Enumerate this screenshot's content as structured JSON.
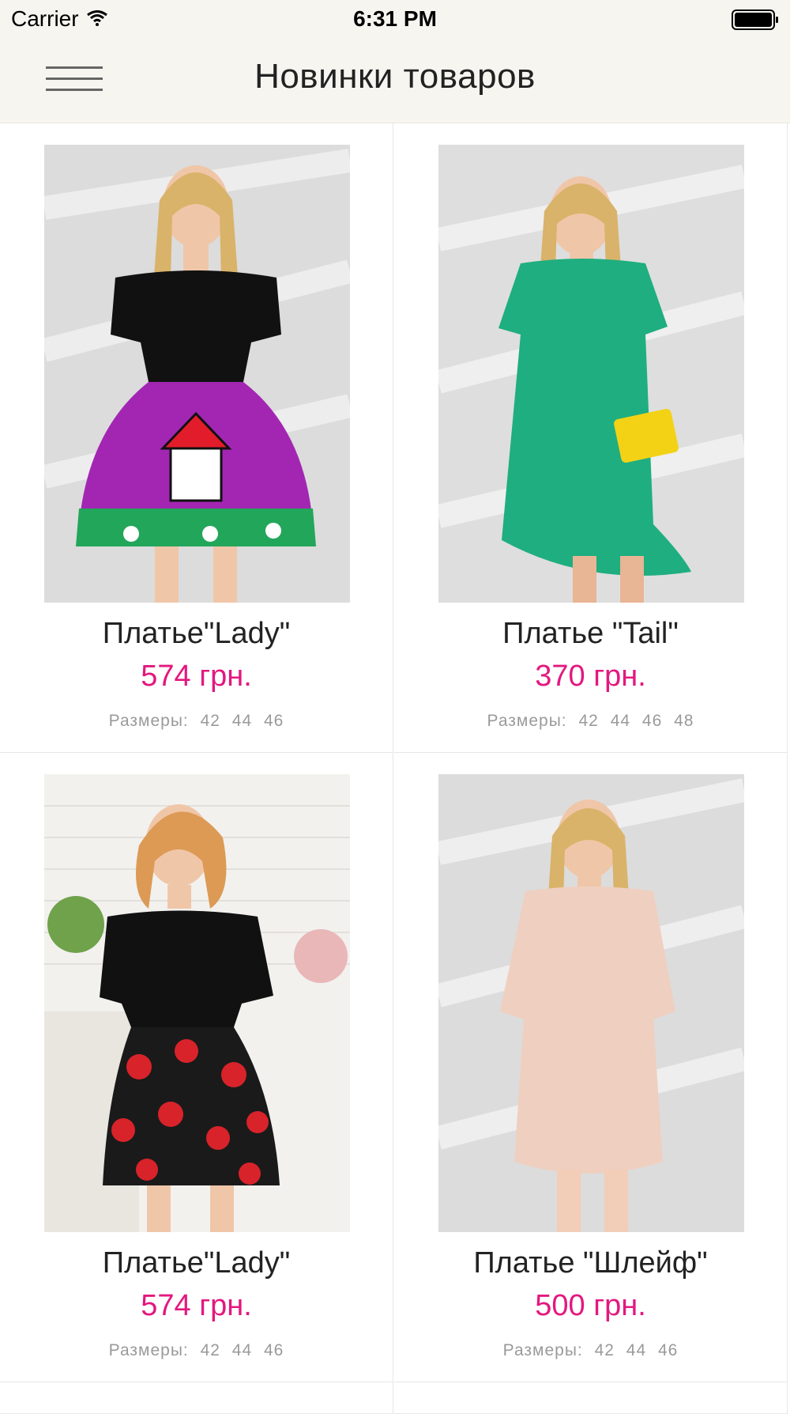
{
  "status_bar": {
    "carrier": "Carrier",
    "time": "6:31 PM"
  },
  "nav": {
    "title": "Новинки товаров",
    "menu_icon": "hamburger-menu-icon"
  },
  "products": [
    {
      "name": "Платье\"Lady\"",
      "price": "574 грн.",
      "sizes_label": "Размеры:",
      "sizes": [
        "42",
        "44",
        "46"
      ]
    },
    {
      "name": "Платье \"Tail\"",
      "price": "370 грн.",
      "sizes_label": "Размеры:",
      "sizes": [
        "42",
        "44",
        "46",
        "48"
      ]
    },
    {
      "name": "Платье\"Lady\"",
      "price": "574 грн.",
      "sizes_label": "Размеры:",
      "sizes": [
        "42",
        "44",
        "46"
      ]
    },
    {
      "name": "Платье \"Шлейф\"",
      "price": "500 грн.",
      "sizes_label": "Размеры:",
      "sizes": [
        "42",
        "44",
        "46"
      ]
    }
  ],
  "colors": {
    "price": "#e3187f",
    "nav_bg": "#f6f5ef"
  }
}
